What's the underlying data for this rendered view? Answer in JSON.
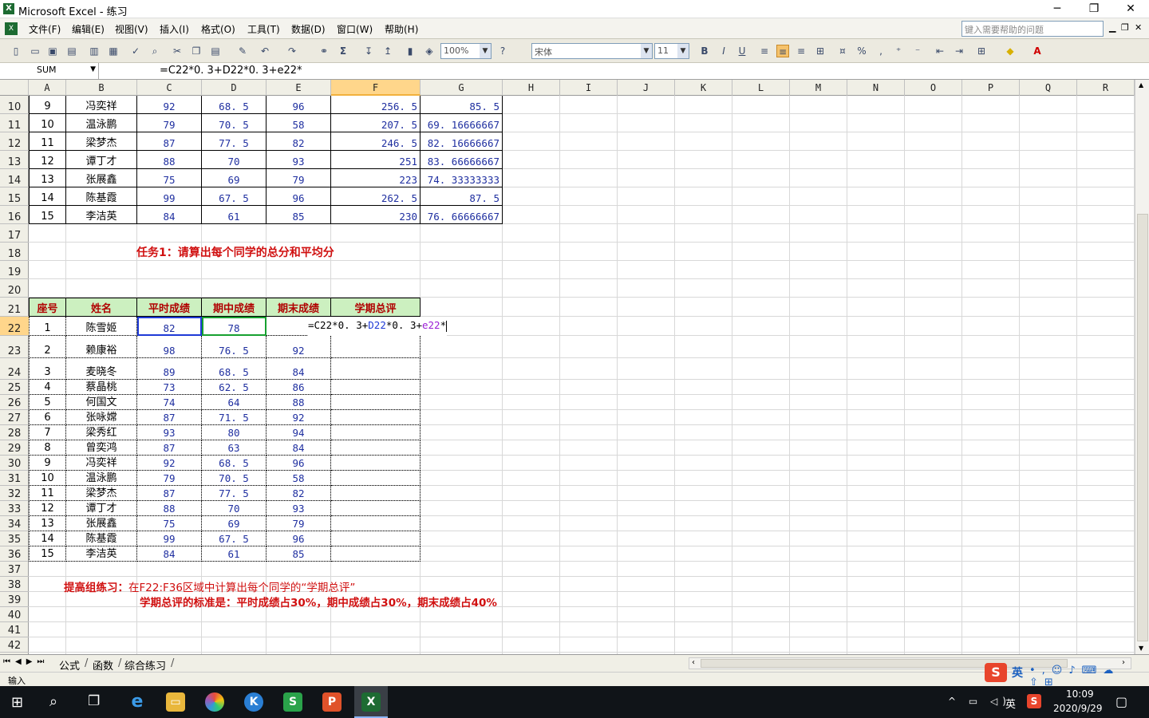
{
  "window": {
    "title": "Microsoft Excel - 练习",
    "min": "─",
    "max": "❐",
    "close": "✕"
  },
  "menu": [
    "文件(F)",
    "编辑(E)",
    "视图(V)",
    "插入(I)",
    "格式(O)",
    "工具(T)",
    "数据(D)",
    "窗口(W)",
    "帮助(H)"
  ],
  "help_placeholder": "键入需要帮助的问题",
  "toolbar": {
    "zoom": "100%",
    "font": "宋体",
    "size": "11",
    "bold": "B",
    "italic": "I",
    "underline": "U",
    "sigma": "Σ",
    "percent": "%"
  },
  "formula": {
    "namebox": "SUM",
    "text": "=C22*0. 3+D22*0. 3+e22*"
  },
  "columns": [
    "A",
    "B",
    "C",
    "D",
    "E",
    "F",
    "G",
    "H",
    "I",
    "J",
    "K",
    "L",
    "M",
    "N",
    "O",
    "P",
    "Q",
    "R"
  ],
  "rows": [
    "10",
    "11",
    "12",
    "13",
    "14",
    "15",
    "16",
    "17",
    "18",
    "19",
    "20",
    "21",
    "22",
    "23",
    "24",
    "25",
    "26",
    "27",
    "28",
    "29",
    "30",
    "31",
    "32",
    "33",
    "34",
    "35",
    "36",
    "37",
    "38",
    "39",
    "40",
    "41",
    "42"
  ],
  "top_table": [
    [
      "9",
      "冯奕祥",
      "92",
      "68. 5",
      "96",
      "256. 5",
      "85. 5"
    ],
    [
      "10",
      "温泳鹏",
      "79",
      "70. 5",
      "58",
      "207. 5",
      "69. 16666667"
    ],
    [
      "11",
      "梁梦杰",
      "87",
      "77. 5",
      "82",
      "246. 5",
      "82. 16666667"
    ],
    [
      "12",
      "谭丁才",
      "88",
      "70",
      "93",
      "251",
      "83. 66666667"
    ],
    [
      "13",
      "张展鑫",
      "75",
      "69",
      "79",
      "223",
      "74. 33333333"
    ],
    [
      "14",
      "陈基霞",
      "99",
      "67. 5",
      "96",
      "262. 5",
      "87. 5"
    ],
    [
      "15",
      "李洁英",
      "84",
      "61",
      "85",
      "230",
      "76. 66666667"
    ]
  ],
  "task1": "任务1：请算出每个同学的总分和平均分",
  "bottom_headers": [
    "座号",
    "姓名",
    "平时成绩",
    "期中成绩",
    "期末成绩",
    "学期总评"
  ],
  "bottom_table": [
    [
      "1",
      "陈雪姬",
      "82",
      "78",
      ""
    ],
    [
      "2",
      "赖康裕",
      "98",
      "76. 5",
      "92"
    ],
    [
      "3",
      "麦晓冬",
      "89",
      "68. 5",
      "84"
    ],
    [
      "4",
      "蔡晶桃",
      "73",
      "62. 5",
      "86"
    ],
    [
      "5",
      "何国文",
      "74",
      "64",
      "88"
    ],
    [
      "6",
      "张咏嫦",
      "87",
      "71. 5",
      "92"
    ],
    [
      "7",
      "梁秀红",
      "93",
      "80",
      "94"
    ],
    [
      "8",
      "曾奕鸿",
      "87",
      "63",
      "84"
    ],
    [
      "9",
      "冯奕祥",
      "92",
      "68. 5",
      "96"
    ],
    [
      "10",
      "温泳鹏",
      "79",
      "70. 5",
      "58"
    ],
    [
      "11",
      "梁梦杰",
      "87",
      "77. 5",
      "82"
    ],
    [
      "12",
      "谭丁才",
      "88",
      "70",
      "93"
    ],
    [
      "13",
      "张展鑫",
      "75",
      "69",
      "79"
    ],
    [
      "14",
      "陈基霞",
      "99",
      "67. 5",
      "96"
    ],
    [
      "15",
      "李洁英",
      "84",
      "61",
      "85"
    ]
  ],
  "edit_formula_parts": [
    "=C22*0. 3+",
    "D22",
    "*0. 3+",
    "e22",
    "*"
  ],
  "note1_bold": "提高组练习：",
  "note1_rest": "在F22:F36区域中计算出每个同学的“学期总评”",
  "note2": "学期总评的标准是：平时成绩占30%，期中成绩占30%，期末成绩占40%",
  "sheets": [
    "公式",
    "函数",
    "综合练习"
  ],
  "status": "输入",
  "tray": {
    "ime": "英",
    "lang": "英",
    "time": "10:09",
    "date": "2020/9/29"
  },
  "colors": {
    "header_fill": "#ccf0c0",
    "selected_header": "#ffd68b",
    "red_text": "#d01010",
    "number_blue": "#1f2fa0"
  }
}
